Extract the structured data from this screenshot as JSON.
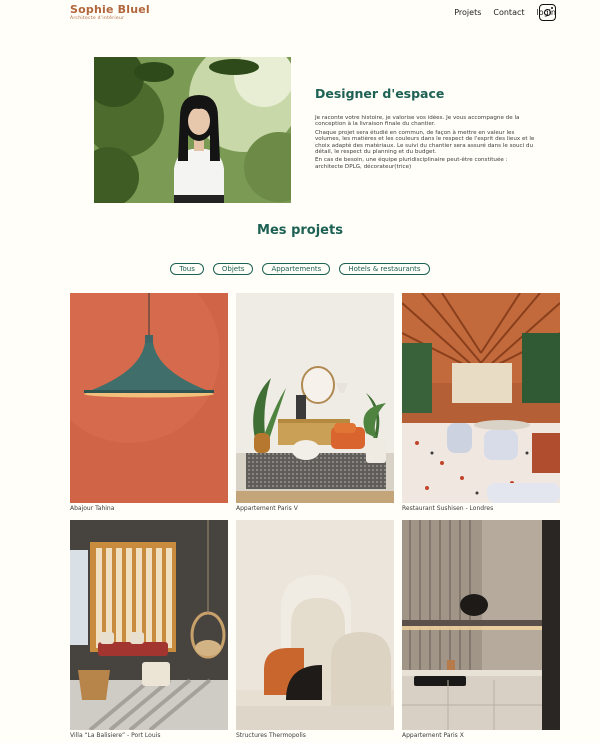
{
  "header": {
    "brand_name": "Sophie Bluel",
    "brand_sub": "Architecte d'intérieur",
    "nav": [
      "Projets",
      "Contact",
      "login"
    ],
    "instagram_icon": "instagram-icon"
  },
  "intro": {
    "title": "Designer d'espace",
    "paragraphs": [
      "Je raconte votre histoire, je valorise vos idées. Je vous accompagne de la conception à la livraison finale du chantier.",
      "Chaque projet sera étudié en commun, de façon à mettre en valeur les volumes, les matières et les couleurs dans le respect de l'esprit des lieux et le choix adapté des matériaux. Le suivi du chantier sera assuré dans le souci du détail, le respect du planning et du budget.",
      "En cas de besoin, une équipe pluridisciplinaire peut-être constituée : architecte DPLG, décorateur(trice)"
    ]
  },
  "projects": {
    "title": "Mes projets",
    "filters": [
      "Tous",
      "Objets",
      "Appartements",
      "Hotels & restaurants"
    ],
    "items": [
      "Abajour Tahina",
      "Appartement Paris V",
      "Restaurant Sushisen - Londres",
      "Villa “La Balisiere” - Port Louis",
      "Structures Thermopolis",
      "Appartement Paris X"
    ]
  },
  "colors": {
    "accent": "#1d6154",
    "brand": "#b1663c",
    "background": "#fffef8"
  }
}
